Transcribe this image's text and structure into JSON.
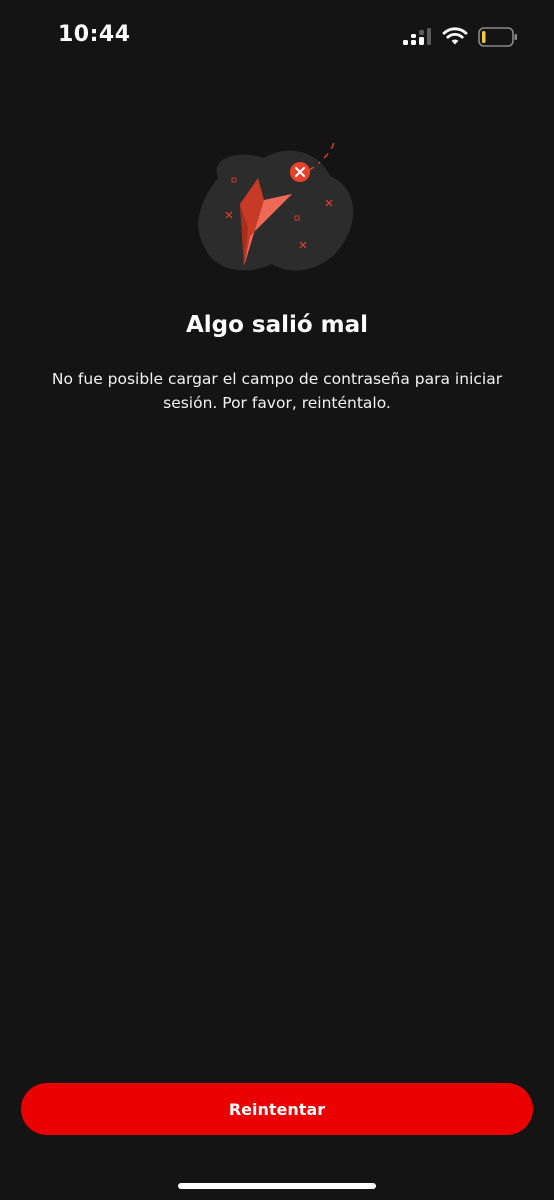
{
  "status_bar": {
    "time": "10:44",
    "icons": [
      "signal-icon",
      "wifi-icon",
      "battery-icon"
    ]
  },
  "error": {
    "title": "Algo salió mal",
    "message": "No fue posible cargar el campo de contraseña para iniciar sesión. Por favor, reinténtalo."
  },
  "actions": {
    "retry_label": "Reintentar"
  },
  "colors": {
    "background": "#141414",
    "accent": "#ea0000",
    "illustration_blob": "#2c2c2c",
    "illustration_red": "#e8412c"
  }
}
